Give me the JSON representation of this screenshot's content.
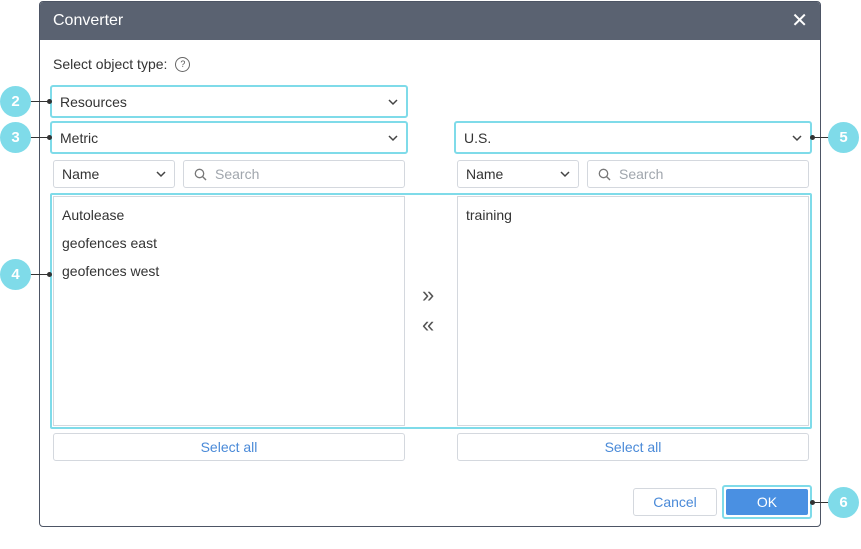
{
  "dialog": {
    "title": "Converter",
    "close_icon": "close-icon"
  },
  "object_type": {
    "label": "Select object type:",
    "help_icon": "?",
    "selected": "Resources"
  },
  "left": {
    "unit_system": "Metric",
    "sort_field": "Name",
    "search_placeholder": "Search",
    "items": [
      "Autolease",
      "geofences east",
      "geofences west"
    ],
    "select_all": "Select all"
  },
  "right": {
    "unit_system": "U.S.",
    "sort_field": "Name",
    "search_placeholder": "Search",
    "items": [
      "training"
    ],
    "select_all": "Select all"
  },
  "transfer": {
    "to_right": "»",
    "to_left": "«"
  },
  "footer": {
    "cancel": "Cancel",
    "ok": "OK"
  },
  "callouts": [
    "2",
    "3",
    "4",
    "5",
    "6"
  ],
  "colors": {
    "highlight": "#7fdbe9",
    "titlebar": "#5a6271",
    "accent": "#4a90e2"
  }
}
